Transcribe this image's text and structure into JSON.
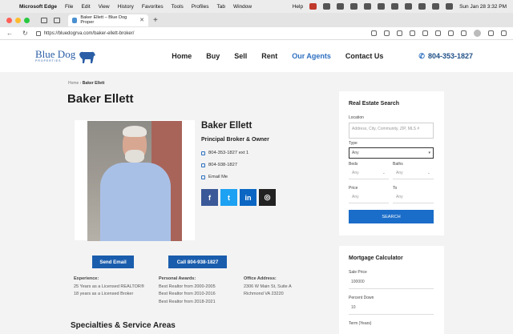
{
  "menubar": {
    "app": "Microsoft Edge",
    "items": [
      "File",
      "Edit",
      "View",
      "History",
      "Favorites",
      "Tools",
      "Profiles",
      "Tab",
      "Window"
    ],
    "help": "Help",
    "clock": "Sun Jan 28  3:32 PM"
  },
  "browser": {
    "tab_title": "Baker Ellett – Blue Dog Proper",
    "url": "https://bluedogrva.com/baker-ellett-broker/",
    "new_tab": "+"
  },
  "site": {
    "logo_text": "Blue Dog",
    "logo_sub": "PROPERTIES",
    "nav": [
      "Home",
      "Buy",
      "Sell",
      "Rent",
      "Our Agents",
      "Contact Us"
    ],
    "nav_active_index": 4,
    "phone": "804-353-1827"
  },
  "breadcrumb": {
    "home": "Home",
    "current": "Baker Ellett"
  },
  "page_title": "Baker Ellett",
  "agent": {
    "name": "Baker Ellett",
    "role": "Principal Broker & Owner",
    "office_phone": "804-353-1827 ext 1",
    "mobile_phone": "804-938-1827",
    "email_label": "Email Me",
    "socials": [
      "facebook",
      "twitter",
      "linkedin",
      "instagram"
    ],
    "send_email": "Send Email",
    "call": "Call 804-938-1827"
  },
  "details": {
    "experience_label": "Experience:",
    "experience": [
      "25 Years as a Licensed REALTOR®",
      "18 years as a Licensed Broker"
    ],
    "awards_label": "Personal Awards:",
    "awards": [
      "Best Realtor from 2000-2005",
      "Best Realtor from 2010-2016",
      "Best Realtor from 2018-2021"
    ],
    "office_label": "Office Address:",
    "office": [
      "2306 W Main St, Suite A",
      "Richmond VA 23220"
    ]
  },
  "specialties_heading": "Specialties & Service Areas",
  "search": {
    "title": "Real Estate Search",
    "location_label": "Location",
    "location_placeholder": "Address, City, Community, ZIP, MLS #",
    "type_label": "Type",
    "type_value": "Any",
    "beds_label": "Beds",
    "beds_value": "Any",
    "baths_label": "Baths",
    "baths_value": "Any",
    "price_label": "Price",
    "price_min": "Any",
    "to_label": "To",
    "price_max": "Any",
    "button": "SEARCH"
  },
  "mortgage": {
    "title": "Mortgage Calculator",
    "sale_price_label": "Sale Price",
    "sale_price": "100000",
    "down_label": "Percent Down",
    "down": "10",
    "term_label": "Term (Years)"
  },
  "colors": {
    "brand": "#1a5dad",
    "nav_active": "#2c6fc0",
    "facebook": "#3b5998",
    "twitter": "#1da1f2",
    "linkedin": "#0a66c2",
    "instagram": "#222222"
  }
}
